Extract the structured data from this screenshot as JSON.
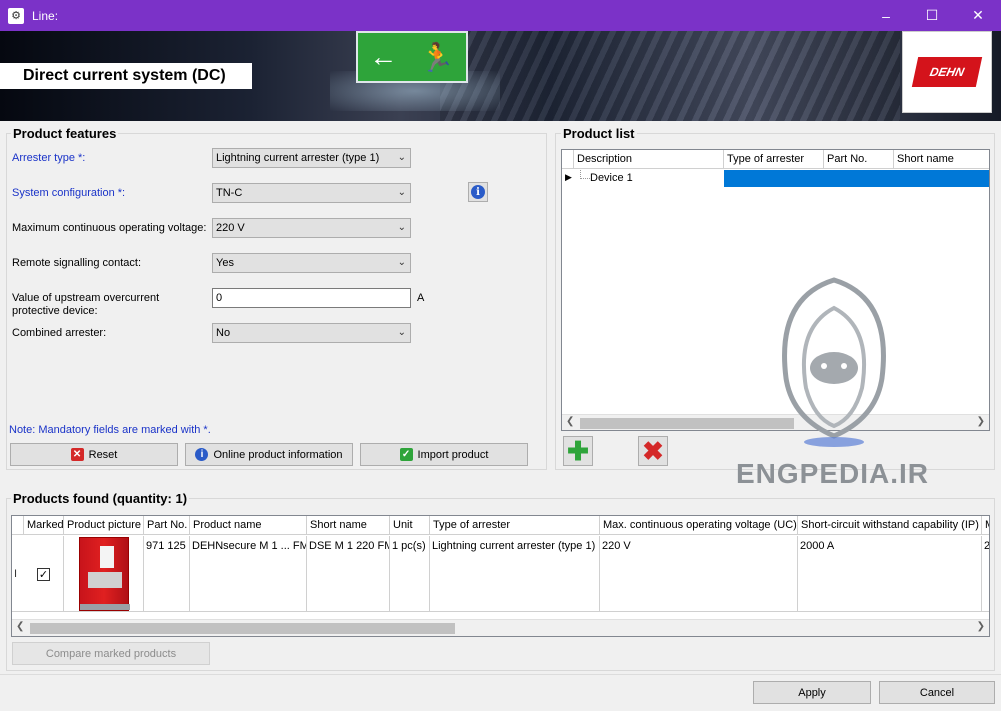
{
  "window": {
    "title": "Line:"
  },
  "banner": {
    "title": "Direct current system (DC)",
    "logo_text": "DEHN"
  },
  "product_features": {
    "title": "Product features",
    "fields": {
      "arrester_type": {
        "label": "Arrester type *:",
        "value": "Lightning current arrester (type 1)"
      },
      "system_configuration": {
        "label": "System configuration *:",
        "value": "TN-C"
      },
      "max_voltage": {
        "label": "Maximum continuous operating voltage:",
        "value": "220 V"
      },
      "remote_signalling": {
        "label": "Remote signalling contact:",
        "value": "Yes"
      },
      "upstream_value": {
        "label_line1": "Value of upstream overcurrent",
        "label_line2": "protective device:",
        "value": "0",
        "unit": "A"
      },
      "combined_arrester": {
        "label": "Combined arrester:",
        "value": "No"
      }
    },
    "note": "Note: Mandatory fields are marked with *.",
    "buttons": {
      "reset": "Reset",
      "online_info": "Online product information",
      "import": "Import product"
    }
  },
  "product_list": {
    "title": "Product list",
    "columns": [
      "Description",
      "Type of arrester",
      "Part No.",
      "Short name"
    ],
    "rows": [
      {
        "description": "Device 1"
      }
    ]
  },
  "products_found": {
    "title": "Products found (quantity: 1)",
    "columns": [
      "Marked",
      "Product picture",
      "Part No.",
      "Product name",
      "Short name",
      "Unit",
      "Type of arrester",
      "Max. continuous operating voltage (UC)",
      "Short-circuit withstand capability (IP)",
      "M"
    ],
    "row": {
      "part_no": "971 125",
      "product_name": "DEHNsecure M 1 ... FM",
      "short_name": "DSE M 1 220 FM",
      "unit": "1 pc(s)",
      "type_of_arrester": "Lightning current arrester (type 1)",
      "max_voltage": "220 V",
      "short_circuit": "2000 A",
      "extra": "2"
    },
    "compare_button": "Compare marked products"
  },
  "footer": {
    "apply": "Apply",
    "cancel": "Cancel"
  },
  "watermark": {
    "text": "ENGPEDIA.IR"
  }
}
